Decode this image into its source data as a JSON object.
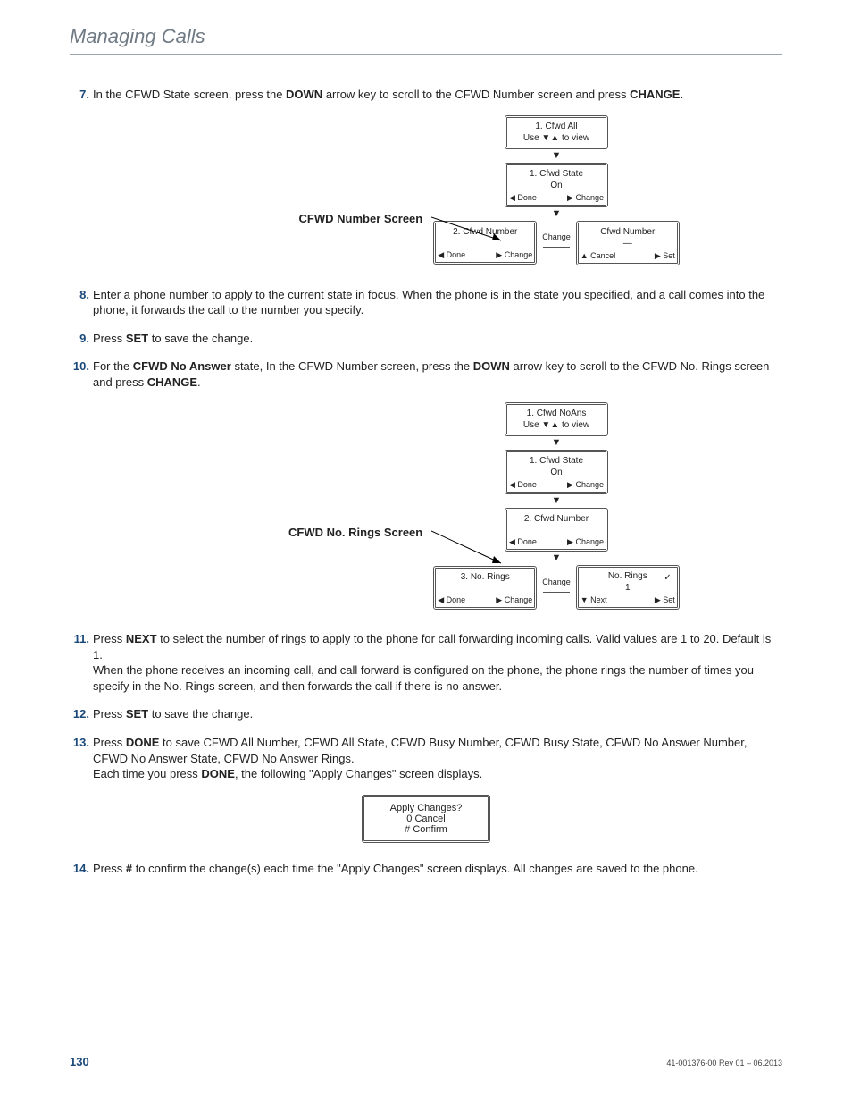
{
  "header": {
    "title": "Managing Calls"
  },
  "steps": {
    "s7": {
      "num": "7.",
      "text_pre": "In the CFWD State screen, press the ",
      "k1": "DOWN",
      "text_mid": " arrow key to scroll to the CFWD Number screen and press ",
      "k2": "CHANGE."
    },
    "s8": {
      "num": "8.",
      "text": "Enter a phone number to apply to the current state in focus. When the phone is in the state you specified, and a call comes into the phone, it forwards the call to the number you specify."
    },
    "s9": {
      "num": "9.",
      "text_pre": "Press ",
      "k1": "SET",
      "text_post": " to save the change."
    },
    "s10": {
      "num": "10.",
      "text_pre": "For the ",
      "k1": "CFWD No Answer",
      "text_mid": " state, In the CFWD Number screen, press the ",
      "k2": "DOWN",
      "text_mid2": " arrow key to scroll to the CFWD No. Rings screen and press ",
      "k3": "CHANGE",
      "text_post": "."
    },
    "s11": {
      "num": "11.",
      "text_pre": "Press ",
      "k1": "NEXT",
      "text_post": " to select the number of rings to apply to the phone for call forwarding incoming calls. Valid values are 1 to 20. Default is 1.",
      "para2": "When the phone receives an incoming call, and call forward is configured on the phone, the phone rings the number of times you specify in the No. Rings screen, and then forwards the call if there is no answer."
    },
    "s12": {
      "num": "12.",
      "text_pre": "Press ",
      "k1": "SET",
      "text_post": " to save the change."
    },
    "s13": {
      "num": "13.",
      "text_pre": "Press ",
      "k1": "DONE",
      "text_post": " to save CFWD All Number, CFWD All State, CFWD Busy Number, CFWD Busy State, CFWD No Answer Number, CFWD No Answer State, CFWD No Answer Rings.",
      "para2_pre": "Each time you press ",
      "k2": "DONE",
      "para2_post": ", the following \"Apply Changes\" screen displays."
    },
    "s14": {
      "num": "14.",
      "text_pre": "Press ",
      "k1": "#",
      "text_post": " to confirm the change(s) each time the \"Apply Changes\" screen displays. All changes are saved to the phone."
    }
  },
  "diagram1": {
    "label": "CFWD Number Screen",
    "box1": {
      "l1": "1. Cfwd All",
      "l2": "Use ▼▲ to view"
    },
    "box2": {
      "l1": "1. Cfwd State",
      "l2": "On",
      "left": "◀ Done",
      "right": "▶ Change"
    },
    "box3": {
      "l1": "2. Cfwd Number",
      "l2": "",
      "left": "◀ Done",
      "right": "▶ Change"
    },
    "change_label": "Change",
    "box4": {
      "l1": "Cfwd Number",
      "l2": "—",
      "left": "▲ Cancel",
      "right": "▶ Set"
    }
  },
  "diagram2": {
    "label": "CFWD No. Rings Screen",
    "box1": {
      "l1": "1. Cfwd NoAns",
      "l2": "Use ▼▲ to view"
    },
    "box2": {
      "l1": "1. Cfwd State",
      "l2": "On",
      "left": "◀ Done",
      "right": "▶ Change"
    },
    "box3": {
      "l1": "2. Cfwd Number",
      "l2": "",
      "left": "◀ Done",
      "right": "▶ Change"
    },
    "box4": {
      "l1": "3. No. Rings",
      "l2": "",
      "left": "◀ Done",
      "right": "▶ Change"
    },
    "change_label": "Change",
    "box5": {
      "l1": "No. Rings",
      "l2": "1",
      "check": "✓",
      "left": "▼ Next",
      "right": "▶ Set"
    }
  },
  "apply_box": {
    "l1": "Apply Changes?",
    "l2": "0 Cancel",
    "l3": "# Confirm"
  },
  "footer": {
    "page": "130",
    "docid": "41-001376-00 Rev 01 – 06.2013"
  }
}
